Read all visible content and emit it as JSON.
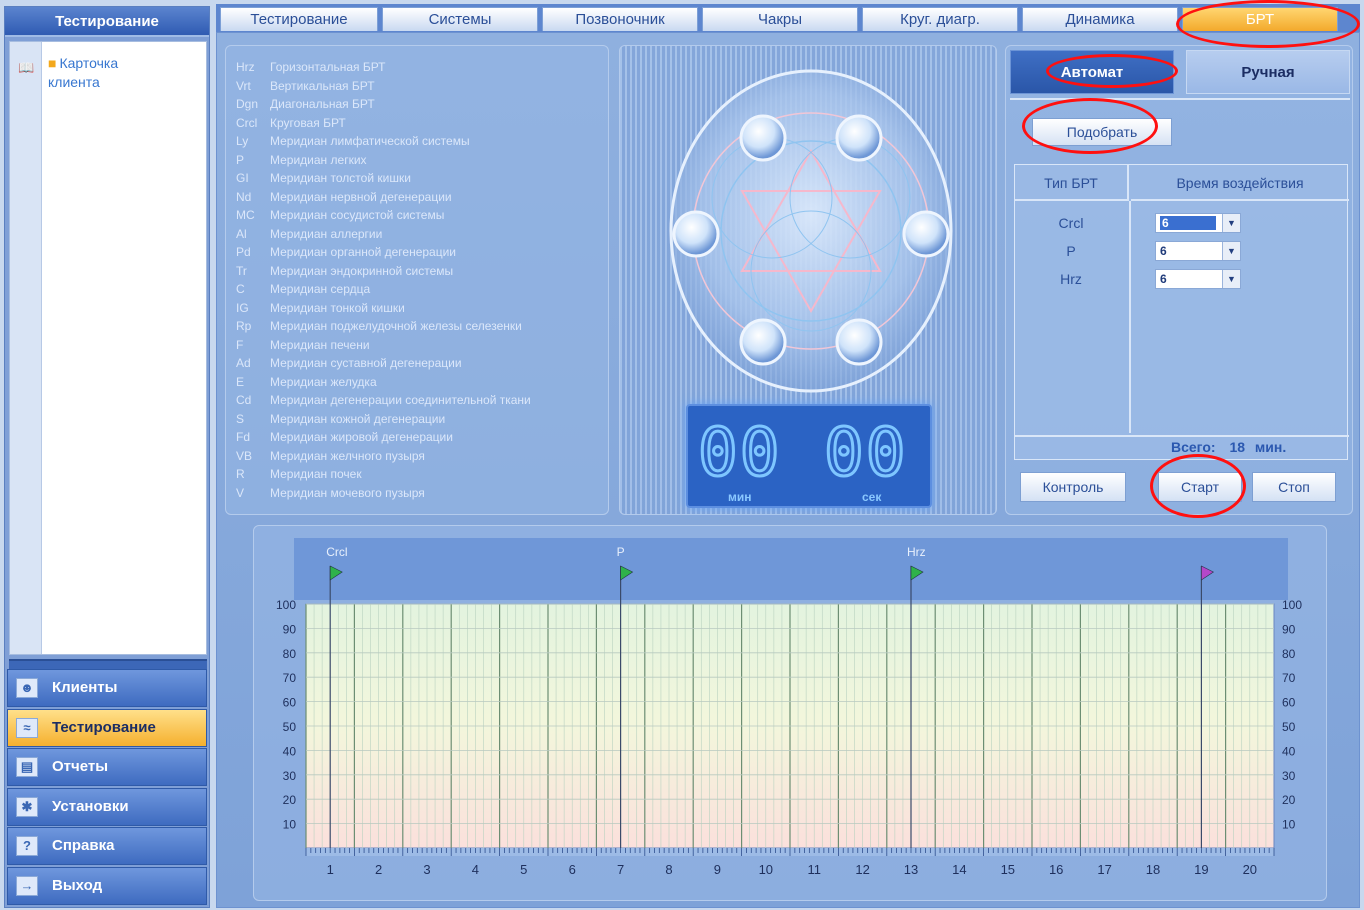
{
  "left_panel": {
    "title": "Тестирование",
    "tree_item": "Карточка клиента",
    "nav": [
      {
        "label": "Клиенты",
        "icon": "clients-icon",
        "active": false
      },
      {
        "label": "Тестирование",
        "icon": "chart-icon",
        "active": true
      },
      {
        "label": "Отчеты",
        "icon": "report-icon",
        "active": false
      },
      {
        "label": "Установки",
        "icon": "settings-icon",
        "active": false
      },
      {
        "label": "Справка",
        "icon": "help-icon",
        "active": false
      },
      {
        "label": "Выход",
        "icon": "exit-icon",
        "active": false
      }
    ]
  },
  "tabs": [
    "Тестирование",
    "Системы",
    "Позвоночник",
    "Чакры",
    "Круг. диагр.",
    "Динамика",
    "БРТ"
  ],
  "active_tab": "БРТ",
  "legend": [
    [
      "Hrz",
      "Горизонтальная БРТ"
    ],
    [
      "Vrt",
      "Вертикальная БРТ"
    ],
    [
      "Dgn",
      "Диагональная БРТ"
    ],
    [
      "Crcl",
      "Круговая БРТ"
    ],
    [
      "Ly",
      "Меридиан лимфатической системы"
    ],
    [
      "P",
      "Меридиан легких"
    ],
    [
      "GI",
      "Меридиан толстой кишки"
    ],
    [
      "Nd",
      "Меридиан нервной дегенерации"
    ],
    [
      "MC",
      "Меридиан сосудистой системы"
    ],
    [
      "Al",
      "Меридиан аллергии"
    ],
    [
      "Pd",
      "Меридиан органной дегенерации"
    ],
    [
      "Tr",
      "Меридиан эндокринной системы"
    ],
    [
      "C",
      "Меридиан сердца"
    ],
    [
      "IG",
      "Меридиан тонкой кишки"
    ],
    [
      "Rp",
      "Меридиан поджелудочной железы селезенки"
    ],
    [
      "F",
      "Меридиан печени"
    ],
    [
      "Ad",
      "Меридиан суставной дегенерации"
    ],
    [
      "E",
      "Меридиан желудка"
    ],
    [
      "Cd",
      "Меридиан дегенерации соединительной ткани"
    ],
    [
      "S",
      "Меридиан кожной дегенерации"
    ],
    [
      "Fd",
      "Меридиан жировой дегенерации"
    ],
    [
      "VB",
      "Меридиан желчного пузыря"
    ],
    [
      "R",
      "Меридиан почек"
    ],
    [
      "V",
      "Меридиан мочевого пузыря"
    ]
  ],
  "timer": {
    "minutes": "00",
    "seconds": "00",
    "min_label": "мин",
    "sec_label": "сек"
  },
  "right_panel": {
    "mode_auto": "Автомат",
    "mode_manual": "Ручная",
    "pick_button": "Подобрать",
    "col_type": "Тип БРТ",
    "col_time": "Время воздействия",
    "rows": [
      {
        "type": "Crcl",
        "time": "6",
        "selected": true
      },
      {
        "type": "P",
        "time": "6",
        "selected": false
      },
      {
        "type": "Hrz",
        "time": "6",
        "selected": false
      }
    ],
    "total_label": "Всего:",
    "total_value": "18",
    "total_unit": "мин.",
    "control_button": "Контроль",
    "start_button": "Старт",
    "stop_button": "Стоп"
  },
  "chart_data": {
    "type": "line",
    "title": "",
    "xlabel": "",
    "ylabel": "",
    "x_ticks": [
      "1",
      "2",
      "3",
      "4",
      "5",
      "6",
      "7",
      "8",
      "9",
      "10",
      "11",
      "12",
      "13",
      "14",
      "15",
      "16",
      "17",
      "18",
      "19",
      "20"
    ],
    "y_ticks": [
      "10",
      "20",
      "30",
      "40",
      "50",
      "60",
      "70",
      "80",
      "90",
      "100"
    ],
    "ylim": [
      0,
      100
    ],
    "segment_markers": [
      {
        "label": "Crcl",
        "x": 0.5,
        "flag_color": "#2fb24a"
      },
      {
        "label": "P",
        "x": 6.5,
        "flag_color": "#2fb24a"
      },
      {
        "label": "Hrz",
        "x": 12.5,
        "flag_color": "#2fb24a"
      },
      {
        "label": "",
        "x": 18.5,
        "flag_color": "#b447c9"
      }
    ],
    "series": []
  },
  "colors": {
    "accent": "#f3a92c",
    "panel_blue": "#7ea2d8",
    "annotation_red": "#ff1010"
  }
}
